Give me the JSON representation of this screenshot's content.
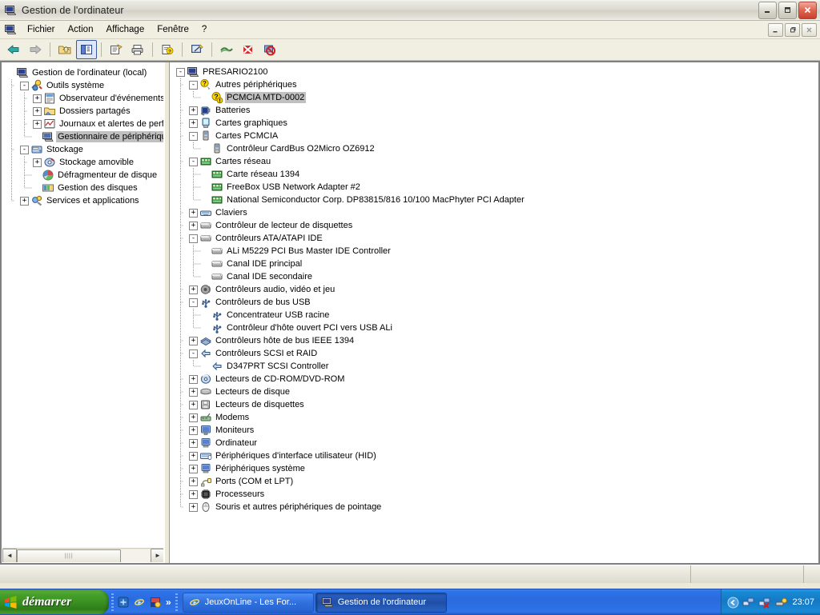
{
  "window": {
    "title": "Gestion de l'ordinateur",
    "icon": "computer-icon",
    "buttons": {
      "minimize": "_",
      "maximize": "❐",
      "close": "✕"
    }
  },
  "menubar": {
    "icon": "mdi-computer-icon",
    "items": [
      {
        "label": "Fichier",
        "name": "menu-fichier"
      },
      {
        "label": "Action",
        "name": "menu-action"
      },
      {
        "label": "Affichage",
        "name": "menu-affichage"
      },
      {
        "label": "Fenêtre",
        "name": "menu-fenetre"
      },
      {
        "label": "?",
        "name": "menu-aide"
      }
    ],
    "mdi_buttons": {
      "minimize": "_",
      "restore": "❐",
      "close": "✕"
    }
  },
  "toolbar": {
    "buttons": [
      {
        "name": "back-button",
        "icon": "arrow-left-icon",
        "enabled": true
      },
      {
        "name": "forward-button",
        "icon": "arrow-right-icon",
        "enabled": false
      },
      {
        "name": "up-one-level-button",
        "icon": "folder-up-icon"
      },
      {
        "name": "show-hide-tree-button",
        "icon": "show-tree-icon",
        "pressed": true
      },
      {
        "name": "properties-button",
        "icon": "properties-icon"
      },
      {
        "name": "print-button",
        "icon": "printer-icon"
      },
      {
        "name": "help-button",
        "icon": "help-document-icon"
      },
      {
        "name": "scan-hardware-changes-button",
        "icon": "scan-hardware-icon"
      },
      {
        "name": "update-driver-button",
        "icon": "update-driver-icon"
      },
      {
        "name": "uninstall-device-button",
        "icon": "uninstall-red-x-icon"
      },
      {
        "name": "disable-device-button",
        "icon": "disable-device-icon"
      }
    ]
  },
  "sidebar": {
    "items": [
      {
        "label": "Gestion de l'ordinateur (local)",
        "icon": "computer-icon",
        "depth": 0,
        "twisty": "",
        "selected": false
      },
      {
        "label": "Outils système",
        "icon": "system-tools-icon",
        "depth": 1,
        "twisty": "-",
        "selected": false
      },
      {
        "label": "Observateur d'événements",
        "icon": "event-viewer-icon",
        "depth": 2,
        "twisty": "+",
        "selected": false
      },
      {
        "label": "Dossiers partagés",
        "icon": "shared-folders-icon",
        "depth": 2,
        "twisty": "+",
        "selected": false
      },
      {
        "label": "Journaux et alertes de perfo",
        "icon": "performance-logs-icon",
        "depth": 2,
        "twisty": "+",
        "selected": false
      },
      {
        "label": "Gestionnaire de périphérique",
        "icon": "device-manager-icon",
        "depth": 2,
        "twisty": "",
        "selected": true
      },
      {
        "label": "Stockage",
        "icon": "storage-icon",
        "depth": 1,
        "twisty": "-",
        "selected": false
      },
      {
        "label": "Stockage amovible",
        "icon": "removable-storage-icon",
        "depth": 2,
        "twisty": "+",
        "selected": false
      },
      {
        "label": "Défragmenteur de disque",
        "icon": "defragmenter-icon",
        "depth": 2,
        "twisty": "",
        "selected": false
      },
      {
        "label": "Gestion des disques",
        "icon": "disk-management-icon",
        "depth": 2,
        "twisty": "",
        "selected": false
      },
      {
        "label": "Services et applications",
        "icon": "services-applications-icon",
        "depth": 1,
        "twisty": "+",
        "selected": false
      }
    ]
  },
  "device_tree": {
    "items": [
      {
        "label": "PRESARIO2100",
        "icon": "computer-icon",
        "depth": 0,
        "twisty": "-",
        "selected": false
      },
      {
        "label": "Autres périphériques",
        "icon": "unknown-device-icon",
        "depth": 1,
        "twisty": "-",
        "selected": false
      },
      {
        "label": "PCMCIA MTD-0002",
        "icon": "warning-device-icon",
        "depth": 2,
        "twisty": "",
        "selected": true
      },
      {
        "label": "Batteries",
        "icon": "battery-icon",
        "depth": 1,
        "twisty": "+",
        "selected": false
      },
      {
        "label": "Cartes graphiques",
        "icon": "display-adapter-icon",
        "depth": 1,
        "twisty": "+",
        "selected": false
      },
      {
        "label": "Cartes PCMCIA",
        "icon": "pcmcia-icon",
        "depth": 1,
        "twisty": "-",
        "selected": false
      },
      {
        "label": "Contrôleur CardBus O2Micro OZ6912",
        "icon": "pcmcia-icon",
        "depth": 2,
        "twisty": "",
        "selected": false
      },
      {
        "label": "Cartes réseau",
        "icon": "network-adapter-icon",
        "depth": 1,
        "twisty": "-",
        "selected": false
      },
      {
        "label": "Carte réseau 1394",
        "icon": "network-adapter-icon",
        "depth": 2,
        "twisty": "",
        "selected": false
      },
      {
        "label": "FreeBox USB Network Adapter #2",
        "icon": "network-adapter-icon",
        "depth": 2,
        "twisty": "",
        "selected": false
      },
      {
        "label": "National Semiconductor Corp. DP83815/816 10/100 MacPhyter PCI Adapter",
        "icon": "network-adapter-icon",
        "depth": 2,
        "twisty": "",
        "selected": false
      },
      {
        "label": "Claviers",
        "icon": "keyboard-icon",
        "depth": 1,
        "twisty": "+",
        "selected": false
      },
      {
        "label": "Contrôleur de lecteur de disquettes",
        "icon": "ide-controller-icon",
        "depth": 1,
        "twisty": "+",
        "selected": false
      },
      {
        "label": "Contrôleurs ATA/ATAPI IDE",
        "icon": "ide-controller-icon",
        "depth": 1,
        "twisty": "-",
        "selected": false
      },
      {
        "label": "ALi M5229 PCI Bus Master IDE Controller",
        "icon": "ide-controller-icon",
        "depth": 2,
        "twisty": "",
        "selected": false
      },
      {
        "label": "Canal IDE principal",
        "icon": "ide-controller-icon",
        "depth": 2,
        "twisty": "",
        "selected": false
      },
      {
        "label": "Canal IDE secondaire",
        "icon": "ide-controller-icon",
        "depth": 2,
        "twisty": "",
        "selected": false
      },
      {
        "label": "Contrôleurs audio, vidéo et jeu",
        "icon": "sound-icon",
        "depth": 1,
        "twisty": "+",
        "selected": false
      },
      {
        "label": "Contrôleurs de bus USB",
        "icon": "usb-icon",
        "depth": 1,
        "twisty": "-",
        "selected": false
      },
      {
        "label": "Concentrateur USB racine",
        "icon": "usb-icon",
        "depth": 2,
        "twisty": "",
        "selected": false
      },
      {
        "label": "Contrôleur d'hôte ouvert PCI vers USB ALi",
        "icon": "usb-icon",
        "depth": 2,
        "twisty": "",
        "selected": false
      },
      {
        "label": "Contrôleurs hôte de bus IEEE 1394",
        "icon": "ieee1394-icon",
        "depth": 1,
        "twisty": "+",
        "selected": false
      },
      {
        "label": "Contrôleurs SCSI et RAID",
        "icon": "scsi-icon",
        "depth": 1,
        "twisty": "-",
        "selected": false
      },
      {
        "label": "D347PRT SCSI Controller",
        "icon": "scsi-icon",
        "depth": 2,
        "twisty": "",
        "selected": false
      },
      {
        "label": "Lecteurs de CD-ROM/DVD-ROM",
        "icon": "cdrom-icon",
        "depth": 1,
        "twisty": "+",
        "selected": false
      },
      {
        "label": "Lecteurs de disque",
        "icon": "disk-drive-icon",
        "depth": 1,
        "twisty": "+",
        "selected": false
      },
      {
        "label": "Lecteurs de disquettes",
        "icon": "floppy-drive-icon",
        "depth": 1,
        "twisty": "+",
        "selected": false
      },
      {
        "label": "Modems",
        "icon": "modem-icon",
        "depth": 1,
        "twisty": "+",
        "selected": false
      },
      {
        "label": "Moniteurs",
        "icon": "monitor-icon",
        "depth": 1,
        "twisty": "+",
        "selected": false
      },
      {
        "label": "Ordinateur",
        "icon": "computer-device-icon",
        "depth": 1,
        "twisty": "+",
        "selected": false
      },
      {
        "label": "Périphériques d'interface utilisateur (HID)",
        "icon": "hid-icon",
        "depth": 1,
        "twisty": "+",
        "selected": false
      },
      {
        "label": "Périphériques système",
        "icon": "system-device-icon",
        "depth": 1,
        "twisty": "+",
        "selected": false
      },
      {
        "label": "Ports (COM et LPT)",
        "icon": "port-icon",
        "depth": 1,
        "twisty": "+",
        "selected": false
      },
      {
        "label": "Processeurs",
        "icon": "processor-icon",
        "depth": 1,
        "twisty": "+",
        "selected": false
      },
      {
        "label": "Souris et autres périphériques de pointage",
        "icon": "mouse-icon",
        "depth": 1,
        "twisty": "+",
        "selected": false
      }
    ]
  },
  "left_scrollbar": {
    "left_arrow": "◄",
    "right_arrow": "►",
    "grip": "||||"
  },
  "statusbar": {
    "text": ""
  },
  "taskbar": {
    "start_label": "démarrer",
    "start_icon": "windows-flag-icon",
    "quicklaunch": [
      {
        "name": "quicklaunch-show-desktop",
        "icon": "show-desktop-icon"
      },
      {
        "name": "quicklaunch-internet-explorer",
        "icon": "internet-explorer-icon"
      },
      {
        "name": "quicklaunch-media-player",
        "icon": "media-player-icon"
      }
    ],
    "quicklaunch_more": "»",
    "tasks": [
      {
        "label": "JeuxOnLine - Les For...",
        "icon": "internet-explorer-icon",
        "active": false,
        "name": "taskbar-button-jeuxonline"
      },
      {
        "label": "Gestion de l'ordinateur",
        "icon": "computer-icon",
        "active": true,
        "name": "taskbar-button-gestion"
      }
    ],
    "tray": {
      "expand_arrow": "‹",
      "icons": [
        {
          "name": "network-connection-icon"
        },
        {
          "name": "network-disconnected-icon"
        },
        {
          "name": "safely-remove-hardware-icon"
        }
      ],
      "clock": "23:07"
    }
  },
  "colors": {
    "desktop": "#5a7edc",
    "selection_inactive": "#c0c0c0",
    "taskbar_blue": "#2a6ade",
    "start_green": "#3a9021"
  }
}
